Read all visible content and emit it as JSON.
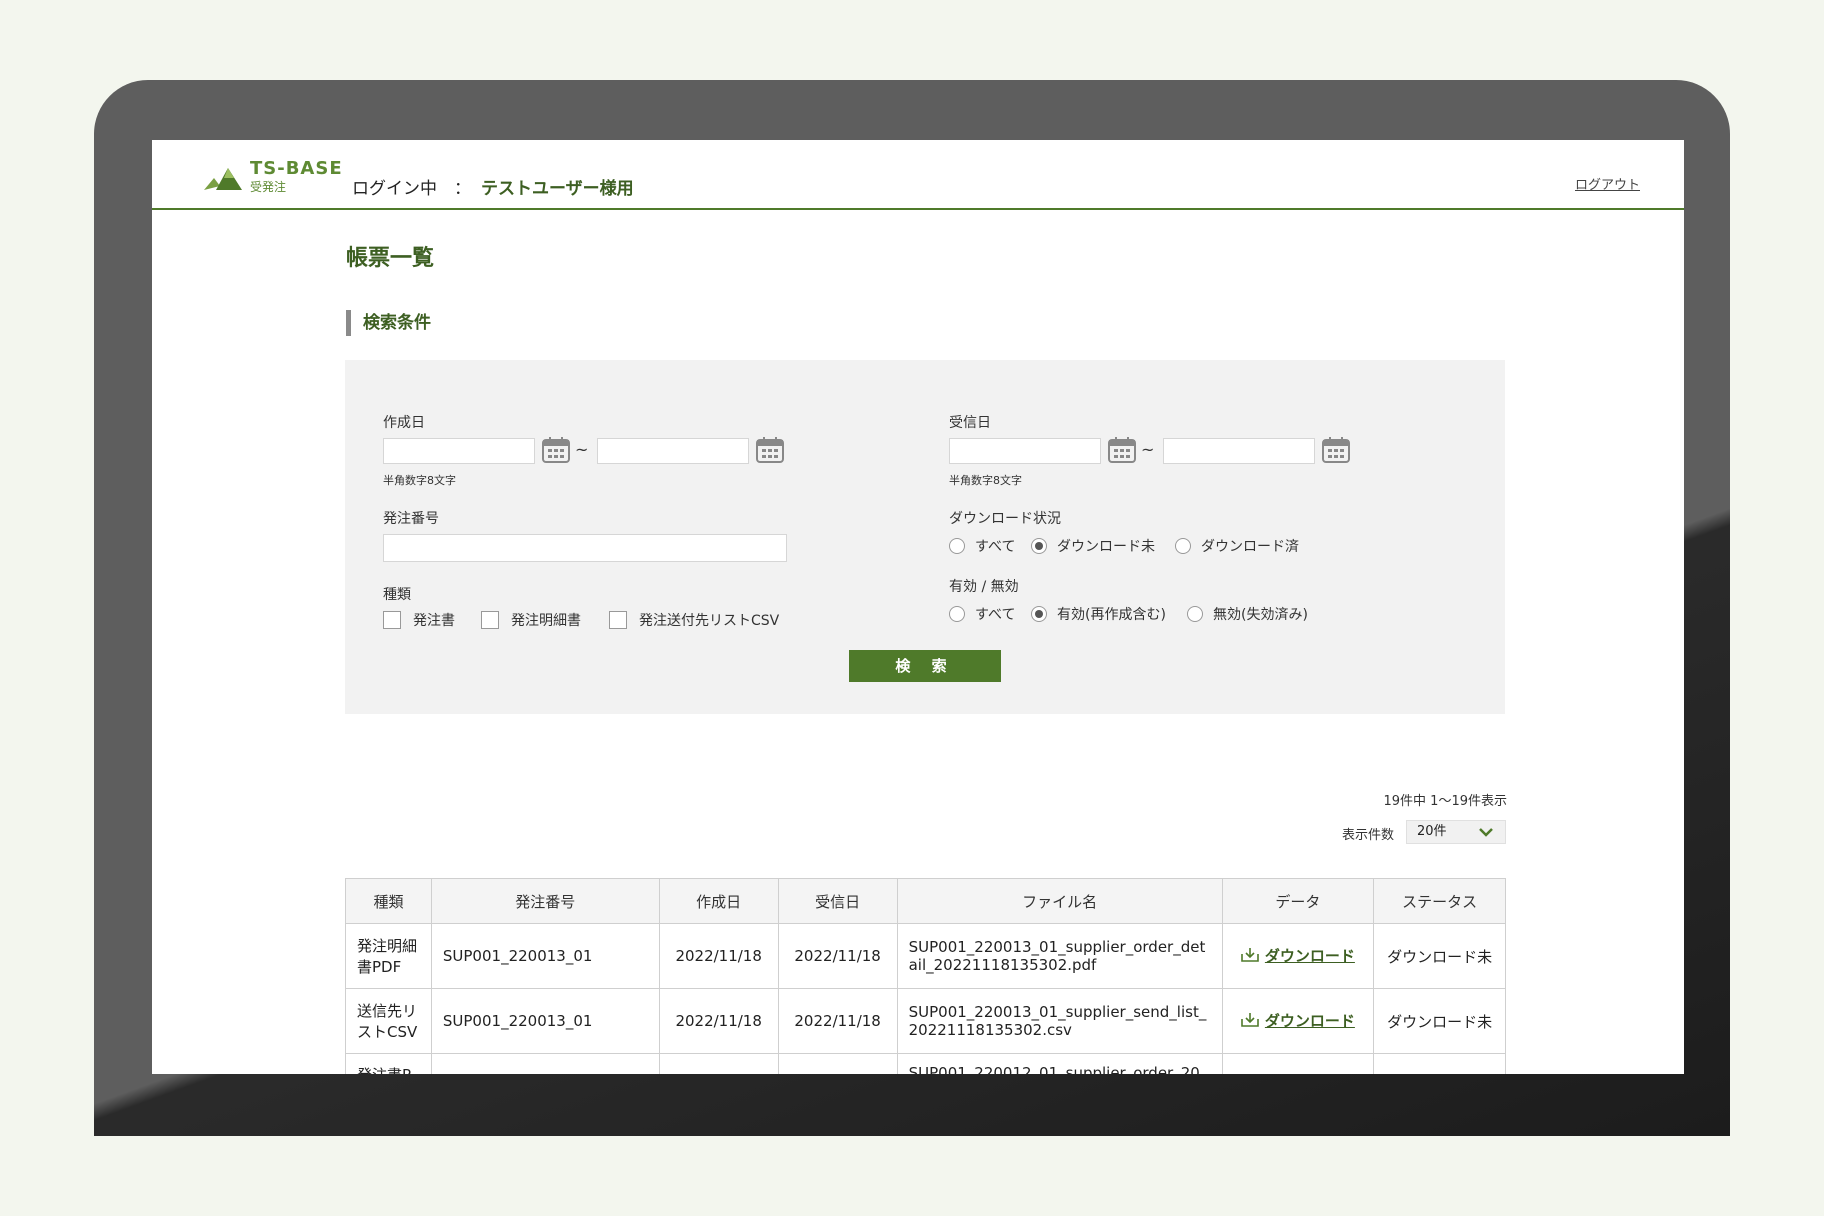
{
  "header": {
    "logo_text": "TS-BASE",
    "logo_sub": "受発注",
    "login_label": "ログイン中　：",
    "user_name": "テストユーザー様用",
    "logout": "ログアウト"
  },
  "page_title": "帳票一覧",
  "section_title": "検索条件",
  "search": {
    "created_label": "作成日",
    "received_label": "受信日",
    "date_hint": "半角数字8文字",
    "tilde": "~",
    "order_no_label": "発注番号",
    "kind_label": "種類",
    "kind_options": [
      "発注書",
      "発注明細書",
      "発注送付先リストCSV"
    ],
    "download_label": "ダウンロード状況",
    "download_options": [
      "すべて",
      "ダウンロード未",
      "ダウンロード済"
    ],
    "download_selected": 1,
    "valid_label": "有効 / 無効",
    "valid_options": [
      "すべて",
      "有効(再作成含む)",
      "無効(失効済み)"
    ],
    "valid_selected": 1,
    "search_button": "検 索"
  },
  "results": {
    "count_text": "19件中 1～19件表示",
    "per_page_label": "表示件数",
    "per_page_value": "20件",
    "columns": [
      "種類",
      "発注番号",
      "作成日",
      "受信日",
      "ファイル名",
      "データ",
      "ステータス"
    ],
    "rows": [
      {
        "kind": "発注明細書PDF",
        "order_no": "SUP001_220013_01",
        "created": "2022/11/18",
        "received": "2022/11/18",
        "file": "SUP001_220013_01_supplier_order_detail_20221118135302.pdf",
        "data": "ダウンロード",
        "status": "ダウンロード未"
      },
      {
        "kind": "送信先リストCSV",
        "order_no": "SUP001_220013_01",
        "created": "2022/11/18",
        "received": "2022/11/18",
        "file": "SUP001_220013_01_supplier_send_list_20221118135302.csv",
        "data": "ダウンロード",
        "status": "ダウンロード未"
      },
      {
        "kind": "発注書P",
        "order_no": "",
        "created": "",
        "received": "",
        "file": "SUP001_220012_01_supplier_order_20",
        "data": "",
        "status": ""
      }
    ]
  },
  "colors": {
    "accent": "#4f7a2a",
    "panel_bg": "#f2f2f2"
  }
}
